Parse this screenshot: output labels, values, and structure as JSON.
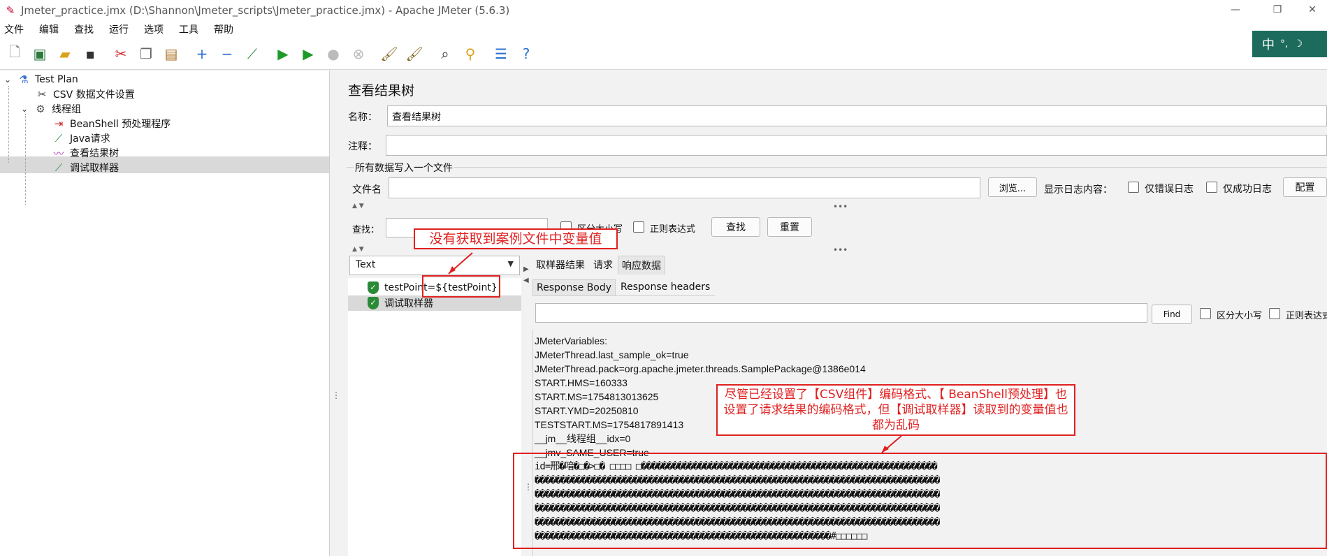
{
  "window": {
    "title": "Jmeter_practice.jmx (D:\\Shannon\\Jmeter_scripts\\Jmeter_practice.jmx) - Apache JMeter (5.6.3)"
  },
  "menu": [
    "文件",
    "编辑",
    "查找",
    "运行",
    "选项",
    "工具",
    "帮助"
  ],
  "ime": {
    "label": "中"
  },
  "tree": {
    "items": [
      {
        "label": "Test Plan",
        "icon": "flask-icon"
      },
      {
        "label": "CSV 数据文件设置",
        "icon": "tools-icon"
      },
      {
        "label": "线程组",
        "icon": "gear-icon"
      },
      {
        "label": "BeanShell 预处理程序",
        "icon": "preprocessor-icon"
      },
      {
        "label": "Java请求",
        "icon": "pipette-icon"
      },
      {
        "label": "查看结果树",
        "icon": "listener-icon"
      },
      {
        "label": "调试取样器",
        "icon": "pipette-icon"
      }
    ],
    "selected": "查看结果树"
  },
  "panel": {
    "title": "查看结果树",
    "name_label": "名称：",
    "name_value": "查看结果树",
    "comment_label": "注释：",
    "comment_value": "",
    "file_section": "所有数据写入一个文件",
    "filename_label": "文件名",
    "filename_value": "",
    "browse_label": "浏览...",
    "log_label": "显示日志内容：",
    "errors_only": "仅错误日志",
    "success_only": "仅成功日志",
    "config_label": "配置",
    "search_label": "查找：",
    "search_value": "",
    "case_sensitive": "区分大小写",
    "regex": "正则表达式",
    "find_label": "查找",
    "reset_label": "重置"
  },
  "results": {
    "renderer": "Text",
    "items": [
      "testPoint=${testPoint}",
      "调试取样器"
    ],
    "selected": "调试取样器"
  },
  "tabs": {
    "main": [
      "取样器结果",
      "请求",
      "响应数据"
    ],
    "main_active": "响应数据",
    "sub": [
      "Response Body",
      "Response headers"
    ],
    "sub_active": "Response Body"
  },
  "response": {
    "search_value": "",
    "find_label": "Find",
    "case_sensitive": "区分大小写",
    "regex": "正则表达式",
    "lines": [
      "JMeterVariables:",
      "JMeterThread.last_sample_ok=true",
      "JMeterThread.pack=org.apache.jmeter.threads.SamplePackage@1386e014",
      "START.HMS=160333",
      "START.MS=1754813013625",
      "START.YMD=20250810",
      "TESTSTART.MS=1754817891413",
      "__jm__线程组__idx=0",
      "__jmv_SAME_USER=true"
    ],
    "garbled": [
      "id=邢�喑�□�>□�            □□□□ □���������������������������������������������������������",
      "������������������������������������������������������������������������������",
      "������������������������������������������������������������������������������",
      "������������������������������������������������������������������������������",
      "������������������������������������������������������������������������������",
      "���������������������������������������������������������#□□□□□□"
    ]
  },
  "annotations": {
    "top": "没有获取到案例文件中变量值",
    "bottom": "尽管已经设置了【CSV组件】编码格式、【 BeanShell预处理】也设置了请求结果的编码格式，但【调试取样器】读取到的变量值也都为乱码",
    "color": "#e02020"
  }
}
